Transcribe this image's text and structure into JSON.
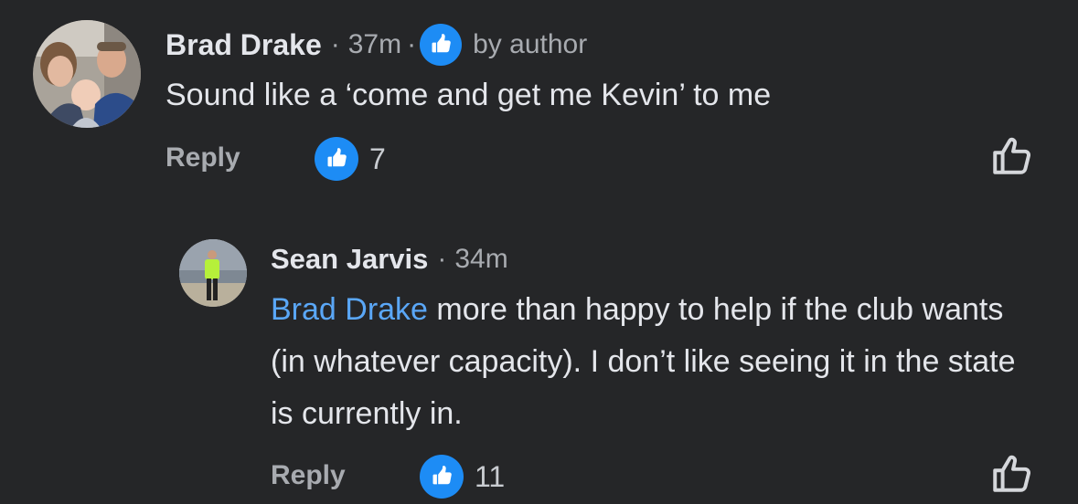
{
  "comments": [
    {
      "author": "Brad Drake",
      "separator": "·",
      "time": "37m",
      "badge_icon": "thumbs-up-badge-icon",
      "badge_text": "by author",
      "text": "Sound like a ‘come and get me Kevin’ to me",
      "reply_label": "Reply",
      "reaction_icon": "like-reaction-icon",
      "reaction_count": "7",
      "like_icon": "thumbs-up-outline-icon"
    },
    {
      "author": "Sean Jarvis",
      "separator": "·",
      "time": "34m",
      "mention": "Brad Drake",
      "text": " more than happy to help if the club wants (in whatever capacity). I don’t like seeing it in the state is currently in.",
      "reply_label": "Reply",
      "reaction_icon": "like-reaction-icon",
      "reaction_count": "11",
      "like_icon": "thumbs-up-outline-icon"
    }
  ],
  "colors": {
    "background": "#252628",
    "primary_text": "#e4e6eb",
    "secondary_text": "#a8abb0",
    "link": "#5aa7f7",
    "like_blue": "#1d8cf5"
  }
}
